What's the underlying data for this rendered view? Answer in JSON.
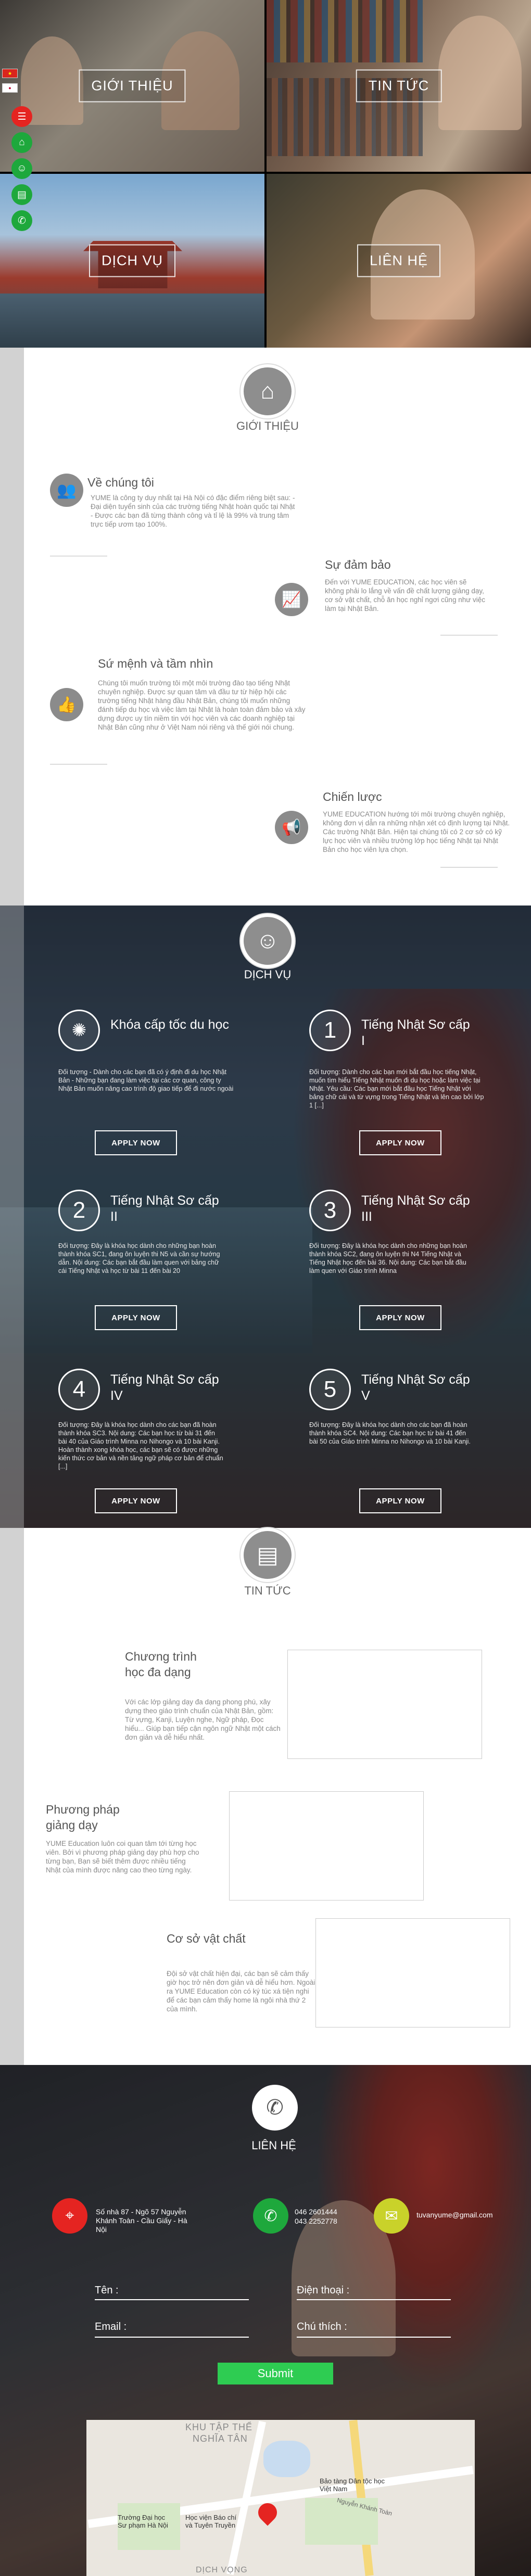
{
  "hero": {
    "tiles": [
      {
        "label": "GIỚI THIỆU"
      },
      {
        "label": "TIN TỨC"
      },
      {
        "label": "DỊCH VỤ"
      },
      {
        "label": "LIÊN HỆ"
      }
    ],
    "sidebar": {
      "flags": [
        "vn-flag",
        "jp-flag"
      ],
      "buttons": [
        "menu-icon",
        "home-icon",
        "user-icon",
        "document-icon",
        "phone-icon"
      ],
      "colors": [
        "#e52421",
        "#1ea83c",
        "#1ea83c",
        "#1ea83c",
        "#1ea83c"
      ]
    }
  },
  "about": {
    "title": "GIỚI THIỆU",
    "icon": "home-icon",
    "blocks": [
      {
        "heading": "Về chúng tôi",
        "icon": "team-icon",
        "text": "YUME là công ty duy nhất tại Hà Nội có đặc điểm riêng biệt sau: - Đại diện tuyển sinh của các trường tiếng Nhật hoàn quốc tại Nhật - Được các bạn đã từng thành công và tỉ lệ là 99% và trung tâm trực tiếp ươm tạo 100%."
      },
      {
        "heading": "Sự đảm bảo",
        "icon": "chart-icon",
        "text": "Đến với YUME EDUCATION, các học viên sẽ không phải lo lắng về vấn đề chất lượng giảng dạy, cơ sở vật chất, chỗ ăn học nghỉ ngơi cũng như việc làm tại Nhật Bản."
      },
      {
        "heading": "Sứ mệnh và tầm nhìn",
        "icon": "thumbs-up-icon",
        "text": "Chúng tôi muốn trường tôi một môi trường đào tạo tiếng Nhật chuyên nghiệp. Được sự quan tâm và đầu tư từ hiệp hội các trường tiếng Nhật hàng đầu Nhật Bản, chúng tôi muốn những đánh tiếp du học và việc làm tại Nhật là hoàn toàn đảm bảo và xây dựng được uy tín niềm tin với học viên và các doanh nghiệp tại Nhật Bản cũng như ở Việt Nam nói riêng và thế giới nói chung."
      },
      {
        "heading": "Chiến lược",
        "icon": "megaphone-icon",
        "text": "YUME EDUCATION hướng tới môi trường chuyên nghiệp, không đơn vị dẫn ra những nhận xét có định lượng tại Nhật. Các trường Nhật Bản. Hiện tại chúng tôi có 2 cơ sở có kỹ lực học viên và nhiều trường lớp học tiếng Nhật tại Nhật Bản cho học viên lựa chọn."
      }
    ]
  },
  "services": {
    "title": "DỊCH VỤ",
    "icon": "support-icon",
    "apply_label": "APPLY NOW",
    "items": [
      {
        "badge": "✺",
        "heading": "Khóa cấp tốc du học",
        "text": "Đối tượng - Dành cho các bạn đã có ý định đi du học Nhật Bản - Những bạn đang làm việc tại các cơ quan, công ty Nhật Bản muốn nâng cao trình độ giao tiếp để đi nước ngoài"
      },
      {
        "badge": "1",
        "heading": "Tiếng Nhật Sơ cấp I",
        "text": "Đối tượng: Dành cho các bạn mới bắt đầu học tiếng Nhật, muốn tìm hiểu Tiếng Nhật muốn đi du học hoặc làm việc tại Nhật. Yêu cầu: Các bạn mới bắt đầu học Tiếng Nhật với bảng chữ cái và từ vựng trong Tiếng Nhật và lên cao bởi lớp 1 [...]"
      },
      {
        "badge": "2",
        "heading": "Tiếng Nhật Sơ cấp II",
        "text": "Đối tượng: Đây là khóa học dành cho những bạn hoàn thành khóa SC1, đang ôn luyện thi N5 và cần sự hướng dẫn. Nội dung: Các bạn bắt đầu làm quen với bảng chữ cái Tiếng Nhật và học từ bài 11 đến bài 20"
      },
      {
        "badge": "3",
        "heading": "Tiếng Nhật Sơ cấp III",
        "text": "Đối tượng: Đây là khóa học dành cho những bạn hoàn thành khóa SC2, đang ôn luyện thi N4 Tiếng Nhật và Tiếng Nhật học đến bài 36. Nội dung: Các bạn bắt đầu làm quen với Giáo trình Minna"
      },
      {
        "badge": "4",
        "heading": "Tiếng Nhật Sơ cấp IV",
        "text": "Đối tượng: Đây là khóa học dành cho các bạn đã hoàn thành khóa SC3. Nội dung: Các bạn học từ bài 31 đến bài 40 của Giáo trình Minna no Nihongo và 10 bài Kanji. Hoàn thành xong khóa học, các bạn sẽ có được những kiến thức cơ bản và nền tảng ngữ pháp cơ bản để chuẩn [...]"
      },
      {
        "badge": "5",
        "heading": "Tiếng Nhật Sơ cấp V",
        "text": "Đối tượng: Đây là khóa học dành cho các bạn đã hoàn thành khóa SC4. Nội dung: Các bạn học từ bài 41 đến bài 50 của Giáo trình Minna no Nihongo và 10 bài Kanji."
      }
    ]
  },
  "news": {
    "title": "TIN TỨC",
    "icon": "document-icon",
    "items": [
      {
        "heading": "Chương trình học đa dạng",
        "text": "Với các lớp giảng dạy đa dạng phong phú, xây dựng theo giáo trình chuẩn của Nhật Bản, gồm: Từ vựng, Kanji, Luyện nghe, Ngữ pháp, Đọc hiểu... Giúp bạn tiếp cận ngôn ngữ Nhật một cách đơn giản và dễ hiểu nhất."
      },
      {
        "heading": "Phương pháp giảng dạy",
        "text": "YUME Education luôn coi quan tâm tới từng học viên. Bởi vì phương pháp giảng dạy phù hợp cho từng bạn, Bạn sẽ biết thêm được nhiều tiếng Nhật của mình được nâng cao theo từng ngày."
      },
      {
        "heading": "Cơ sở vật chất",
        "text": "Đội sở vật chất hiện đại, các bạn sẽ cảm thấy giờ học trở nên đơn giản và dễ hiểu hơn. Ngoài ra YUME Education còn có ký túc xá tiện nghi để các bạn cảm thấy home là ngôi nhà thứ 2 của mình."
      }
    ]
  },
  "contact": {
    "title": "LIÊN HỆ",
    "icon": "phone-icon",
    "address": "Số nhà 87 - Ngõ 57 Nguyễn Khánh Toàn - Cầu Giấy - Hà Nội",
    "phone1": "046 2601444",
    "phone2": "043 2252778",
    "email": "tuvanyume@gmail.com",
    "form": {
      "name_label": "Tên :",
      "phone_label": "Điện thoại :",
      "email_label": "Email :",
      "note_label": "Chú thích :",
      "submit_label": "Submit"
    },
    "map": {
      "area_label_1": "KHU TẬP THỂ",
      "area_label_2": "NGHĨA TÂN",
      "poi_1": "Bảo tàng Dân tộc học Việt Nam",
      "poi_2": "Trường Đại học Sư phạm Hà Nội",
      "poi_3": "Học viện Báo chí và Tuyên Truyền",
      "area_bottom": "DỊCH VỌNG",
      "road": "Nguyễn Khánh Toàn"
    }
  }
}
